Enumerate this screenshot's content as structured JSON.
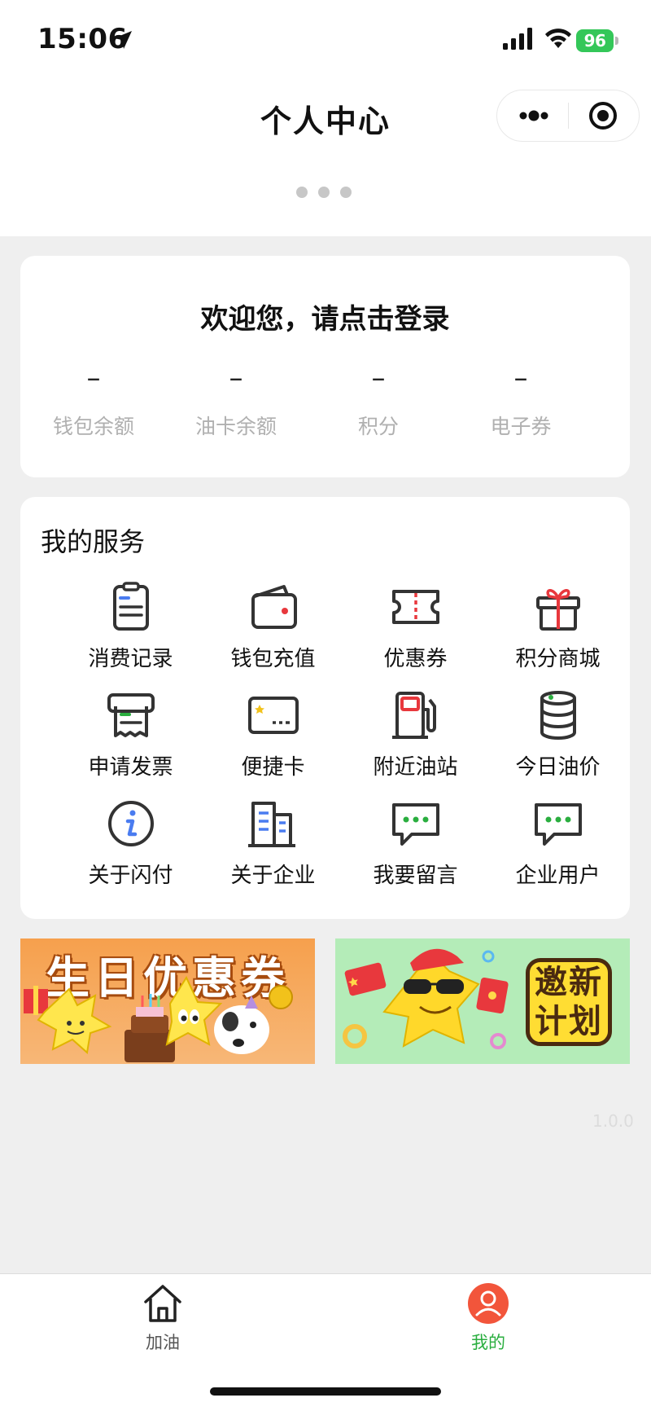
{
  "status_bar": {
    "time": "15:06",
    "battery": "96"
  },
  "nav": {
    "title": "个人中心"
  },
  "user_card": {
    "login_prompt": "欢迎您，请点击登录",
    "stats": [
      {
        "value": "–",
        "label": "钱包余额"
      },
      {
        "value": "–",
        "label": "油卡余额"
      },
      {
        "value": "–",
        "label": "积分"
      },
      {
        "value": "–",
        "label": "电子券"
      }
    ]
  },
  "services": {
    "title": "我的服务",
    "items": [
      {
        "label": "消费记录",
        "icon": "clipboard-icon"
      },
      {
        "label": "钱包充值",
        "icon": "wallet-icon"
      },
      {
        "label": "优惠券",
        "icon": "ticket-icon"
      },
      {
        "label": "积分商城",
        "icon": "gift-icon"
      },
      {
        "label": "申请发票",
        "icon": "invoice-icon"
      },
      {
        "label": "便捷卡",
        "icon": "card-icon"
      },
      {
        "label": "附近油站",
        "icon": "fuel-pump-icon"
      },
      {
        "label": "今日油价",
        "icon": "oil-barrel-icon"
      },
      {
        "label": "关于闪付",
        "icon": "info-icon"
      },
      {
        "label": "关于企业",
        "icon": "building-icon"
      },
      {
        "label": "我要留言",
        "icon": "message-icon"
      },
      {
        "label": "企业用户",
        "icon": "chat-icon"
      }
    ]
  },
  "banners": {
    "left": {
      "title": "生日优惠券"
    },
    "right": {
      "line1": "邀新",
      "line2": "计划"
    }
  },
  "version": "1.0.0",
  "tabbar": {
    "items": [
      {
        "label": "加油",
        "icon": "home-icon"
      },
      {
        "label": "我的",
        "icon": "user-icon"
      }
    ]
  },
  "colors": {
    "accent_green": "#2aae3f",
    "icon_red": "#e8383d",
    "battery_green": "#34c759",
    "avatar_red": "#f2553b"
  }
}
